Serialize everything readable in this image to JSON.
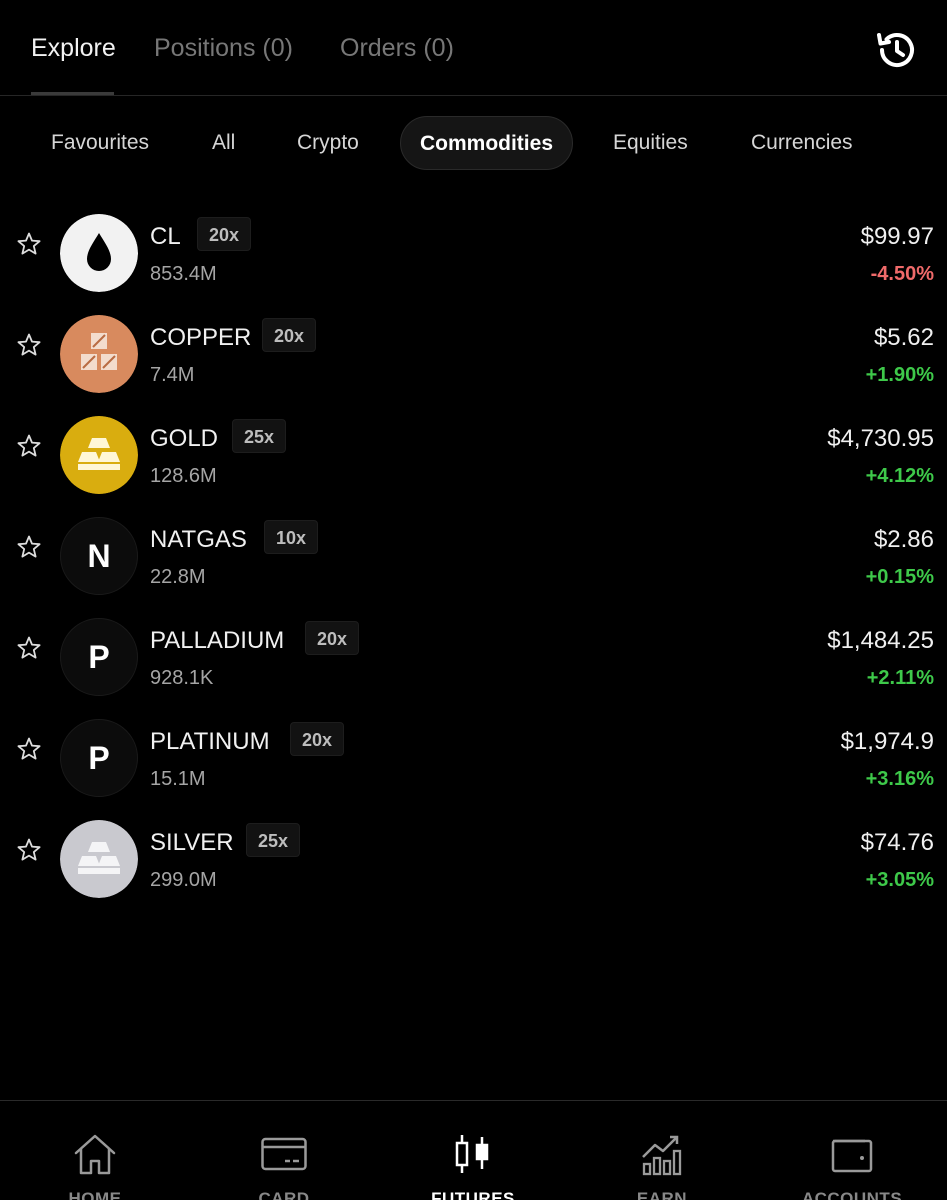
{
  "top_tabs": [
    {
      "label": "Explore",
      "active": true
    },
    {
      "label": "Positions (0)",
      "active": false
    },
    {
      "label": "Orders (0)",
      "active": false
    }
  ],
  "categories": [
    {
      "label": "Favourites",
      "active": false
    },
    {
      "label": "All",
      "active": false
    },
    {
      "label": "Crypto",
      "active": false
    },
    {
      "label": "Commodities",
      "active": true
    },
    {
      "label": "Equities",
      "active": false
    },
    {
      "label": "Currencies",
      "active": false
    }
  ],
  "markets": [
    {
      "symbol": "CL",
      "leverage": "20x",
      "volume": "853.4M",
      "price": "$99.97",
      "change": "-4.50%",
      "direction": "negative",
      "icon": "oil-drop-icon"
    },
    {
      "symbol": "COPPER",
      "leverage": "20x",
      "volume": "7.4M",
      "price": "$5.62",
      "change": "+1.90%",
      "direction": "positive",
      "icon": "copper-blocks-icon"
    },
    {
      "symbol": "GOLD",
      "leverage": "25x",
      "volume": "128.6M",
      "price": "$4,730.95",
      "change": "+4.12%",
      "direction": "positive",
      "icon": "gold-bars-icon"
    },
    {
      "symbol": "NATGAS",
      "leverage": "10x",
      "volume": "22.8M",
      "price": "$2.86",
      "change": "+0.15%",
      "direction": "positive",
      "icon": "letter-n-icon",
      "letter": "N"
    },
    {
      "symbol": "PALLADIUM",
      "leverage": "20x",
      "volume": "928.1K",
      "price": "$1,484.25",
      "change": "+2.11%",
      "direction": "positive",
      "icon": "letter-p-icon",
      "letter": "P"
    },
    {
      "symbol": "PLATINUM",
      "leverage": "20x",
      "volume": "15.1M",
      "price": "$1,974.9",
      "change": "+3.16%",
      "direction": "positive",
      "icon": "letter-p-icon",
      "letter": "P"
    },
    {
      "symbol": "SILVER",
      "leverage": "25x",
      "volume": "299.0M",
      "price": "$74.76",
      "change": "+3.05%",
      "direction": "positive",
      "icon": "silver-bars-icon"
    }
  ],
  "bottom_nav": [
    {
      "label": "HOME",
      "icon": "home-icon",
      "active": false
    },
    {
      "label": "CARD",
      "icon": "card-icon",
      "active": false
    },
    {
      "label": "FUTURES",
      "icon": "candlestick-icon",
      "active": true
    },
    {
      "label": "EARN",
      "icon": "chart-growth-icon",
      "active": false
    },
    {
      "label": "ACCOUNTS",
      "icon": "wallet-icon",
      "active": false
    }
  ],
  "colors": {
    "background": "#000000",
    "negative": "#f06a6a",
    "positive": "#3ec94a",
    "copper": "#d88a5e",
    "gold": "#d9ad0f",
    "silver": "#c9c9cf"
  }
}
